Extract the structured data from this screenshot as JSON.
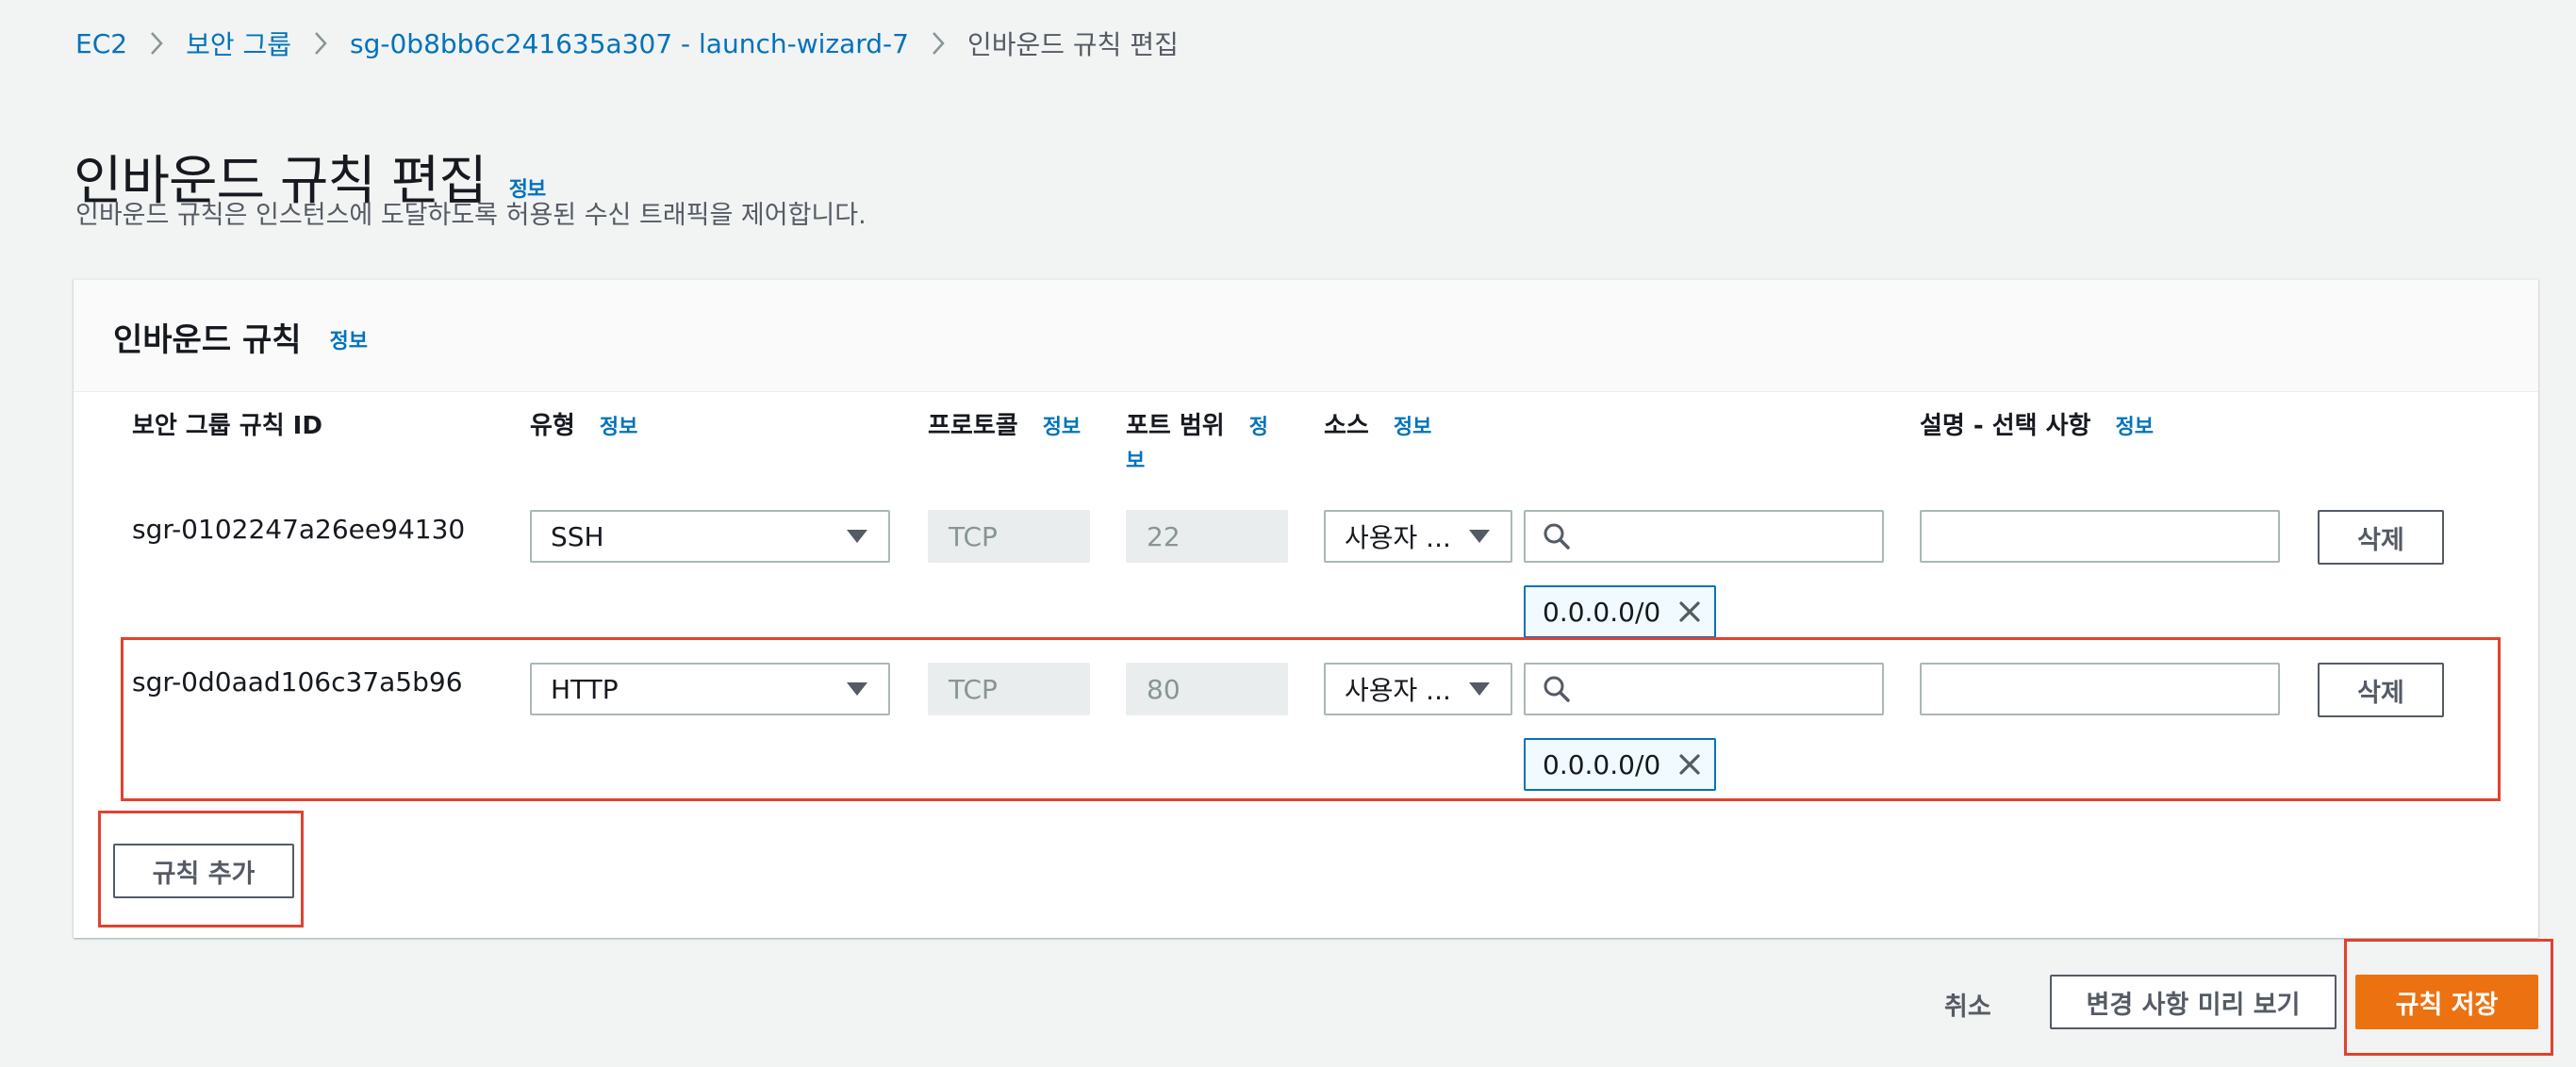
{
  "breadcrumb": {
    "items": [
      "EC2",
      "보안 그룹",
      "sg-0b8bb6c241635a307 - launch-wizard-7"
    ],
    "current": "인바운드 규칙 편집"
  },
  "page": {
    "title": "인바운드 규칙 편집",
    "info": "정보",
    "description": "인바운드 규칙은 인스턴스에 도달하도록 허용된 수신 트래픽을 제어합니다."
  },
  "panel": {
    "title": "인바운드 규칙",
    "info": "정보",
    "columns": {
      "rule_id": "보안 그룹 규칙 ID",
      "type": "유형",
      "protocol": "프로토콜",
      "port_range_line1": "포트 범위",
      "port_range_info_line1": "정",
      "port_range_info_line2": "보",
      "source": "소스",
      "description": "설명 - 선택 사항",
      "info": "정보"
    },
    "rows": [
      {
        "rule_id": "sgr-0102247a26ee94130",
        "type": "SSH",
        "protocol": "TCP",
        "port": "22",
        "source_type": "사용자 ...",
        "source_search_value": "",
        "cidr": "0.0.0.0/0",
        "description": "",
        "delete_label": "삭제"
      },
      {
        "rule_id": "sgr-0d0aad106c37a5b96",
        "type": "HTTP",
        "protocol": "TCP",
        "port": "80",
        "source_type": "사용자 ...",
        "source_search_value": "",
        "cidr": "0.0.0.0/0",
        "description": "",
        "delete_label": "삭제"
      }
    ],
    "add_rule_label": "규칙 추가"
  },
  "footer": {
    "cancel_label": "취소",
    "preview_label": "변경 사항 미리 보기",
    "save_label": "규칙 저장"
  },
  "colors": {
    "link": "#0073bb",
    "primary": "#ec7211",
    "highlight": "#e0422f",
    "background": "#f2f3f3"
  }
}
